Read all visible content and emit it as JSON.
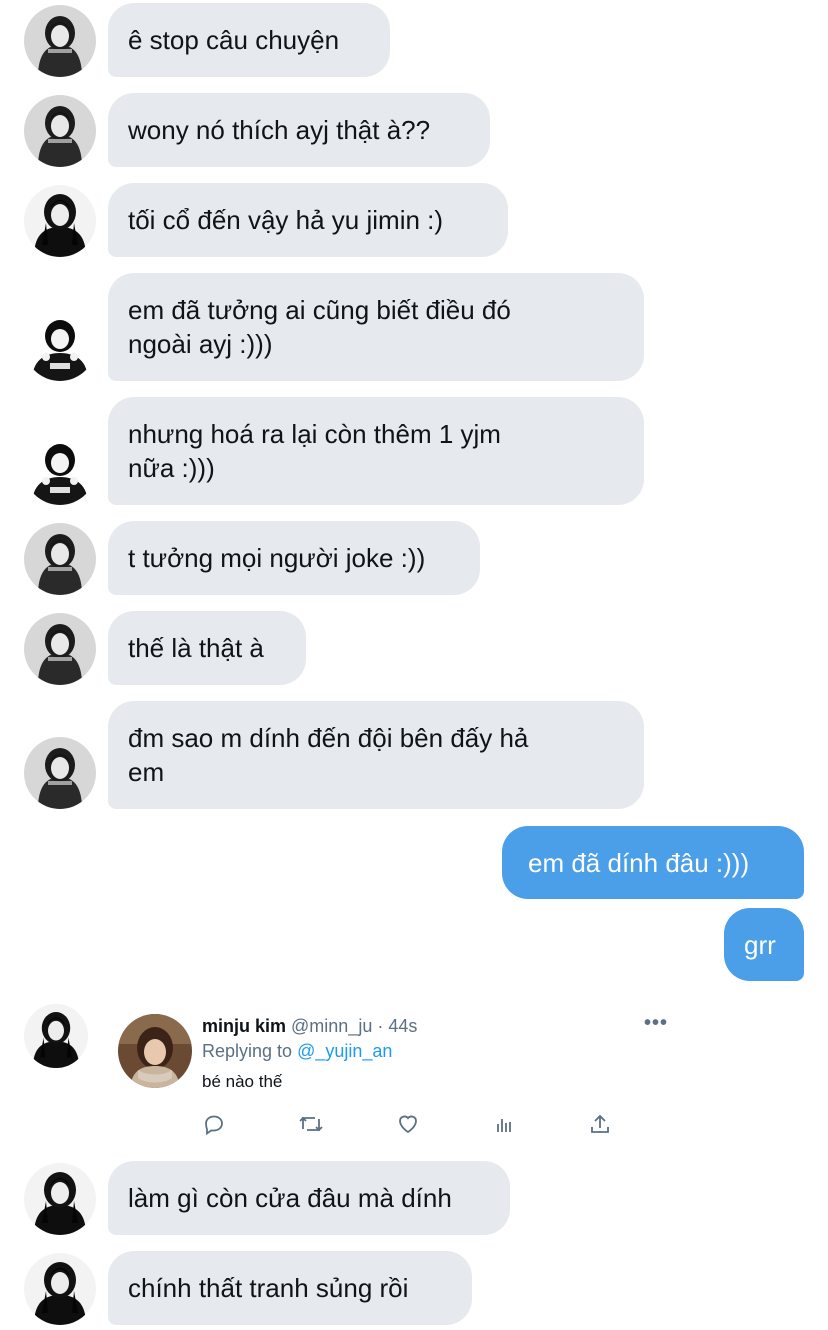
{
  "messages": [
    {
      "text": "ê stop câu chuyện",
      "from": "them"
    },
    {
      "text": "wony nó thích ayj thật à??",
      "from": "them"
    },
    {
      "text": "tối cổ đến vậy hả yu jimin :)",
      "from": "them"
    },
    {
      "text": "em đã tưởng ai cũng biết điều đó\nngoài ayj :)))",
      "from": "them"
    },
    {
      "text": "nhưng hoá ra lại còn thêm 1 yjm\nnữa :)))",
      "from": "them"
    },
    {
      "text": "t tưởng mọi người joke :))",
      "from": "them"
    },
    {
      "text": "thế là thật à",
      "from": "them"
    },
    {
      "text": "đm sao m dính đến đội bên đấy hả\nem",
      "from": "them"
    },
    {
      "text": "em đã dính đâu :)))",
      "from": "me"
    },
    {
      "text": "grr",
      "from": "me"
    },
    {
      "text": "làm gì còn cửa đâu mà dính",
      "from": "them"
    },
    {
      "text": "chính thất tranh sủng rồi",
      "from": "them"
    }
  ],
  "tweet": {
    "name": "minju kim",
    "handle": "@minn_ju",
    "separator": "·",
    "time": "44s",
    "replying_prefix": "Replying to",
    "replying_to": "@_yujin_an",
    "text": "bé nào thế",
    "more": "•••",
    "actions": [
      "reply-icon",
      "retweet-icon",
      "like-icon",
      "analytics-icon",
      "share-icon"
    ]
  },
  "colors": {
    "incoming_bubble": "#e6e9ee",
    "outgoing_bubble": "#4b9ee8",
    "mention": "#1d9bf0",
    "muted": "#5b7083"
  }
}
